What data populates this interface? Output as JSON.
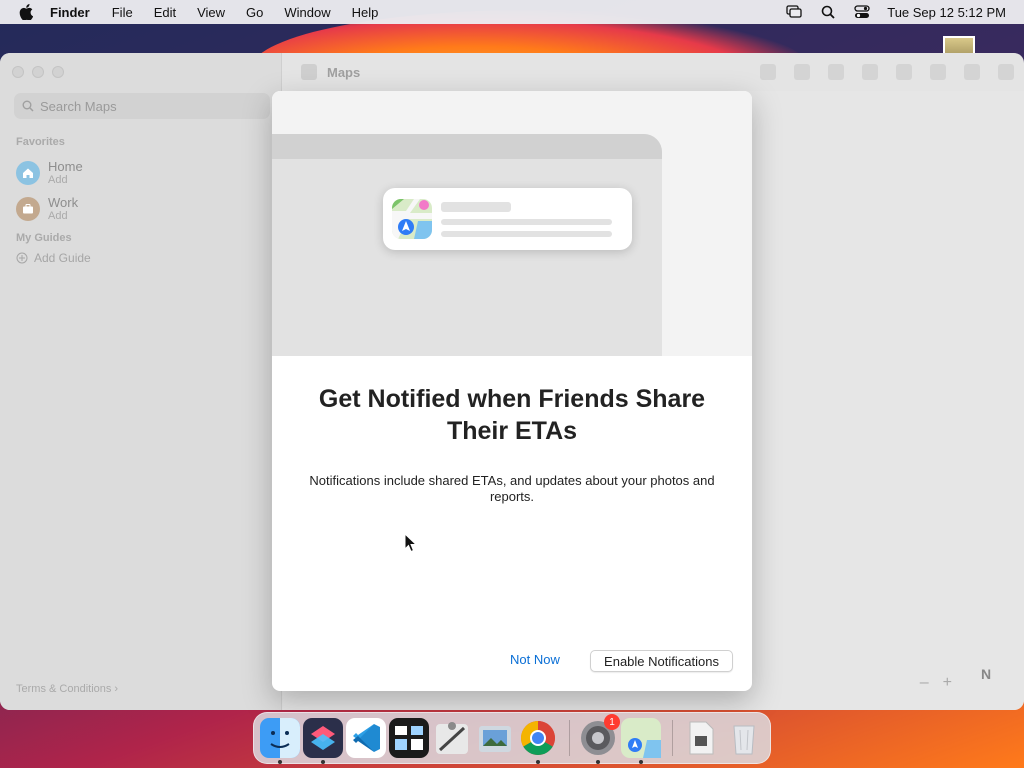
{
  "menubar": {
    "app_name": "Finder",
    "items": [
      "File",
      "Edit",
      "View",
      "Go",
      "Window",
      "Help"
    ],
    "clock": "Tue Sep 12  5:12 PM"
  },
  "maps_window": {
    "title": "Maps",
    "search_placeholder": "Search Maps",
    "favorites_label": "Favorites",
    "favorites": [
      {
        "name": "Home",
        "sub": "Add",
        "color": "#5aaee0"
      },
      {
        "name": "Work",
        "sub": "Add",
        "color": "#b08a6a"
      }
    ],
    "guides_label": "My Guides",
    "add_guide": "Add Guide",
    "terms": "Terms & Conditions",
    "zoom_out": "–",
    "zoom_in": "+",
    "compass": "N"
  },
  "modal": {
    "headline": "Get Notified when Friends Share Their ETAs",
    "body": "Notifications include shared ETAs, and updates about your photos and reports.",
    "not_now": "Not Now",
    "enable": "Enable Notifications",
    "accent": "#0a6fd6"
  },
  "dock": {
    "apps": [
      {
        "name": "Finder",
        "icon": "finder-icon",
        "running": true
      },
      {
        "name": "Shortcuts",
        "icon": "shortcuts-icon",
        "running": true
      },
      {
        "name": "Visual Studio Code",
        "icon": "vscode-icon",
        "running": false
      },
      {
        "name": "Mission Control",
        "icon": "mission-control-icon",
        "running": false
      },
      {
        "name": "Script Editor",
        "icon": "script-editor-icon",
        "running": false
      },
      {
        "name": "Preview",
        "icon": "preview-icon",
        "running": false
      },
      {
        "name": "Chrome",
        "icon": "chrome-icon",
        "running": true
      },
      {
        "name": "System Settings",
        "icon": "settings-icon",
        "running": true,
        "badge": "1"
      },
      {
        "name": "Maps",
        "icon": "maps-icon",
        "running": true
      },
      {
        "name": "Files",
        "icon": "document-icon",
        "running": false
      },
      {
        "name": "Trash",
        "icon": "trash-icon",
        "running": false
      }
    ]
  }
}
